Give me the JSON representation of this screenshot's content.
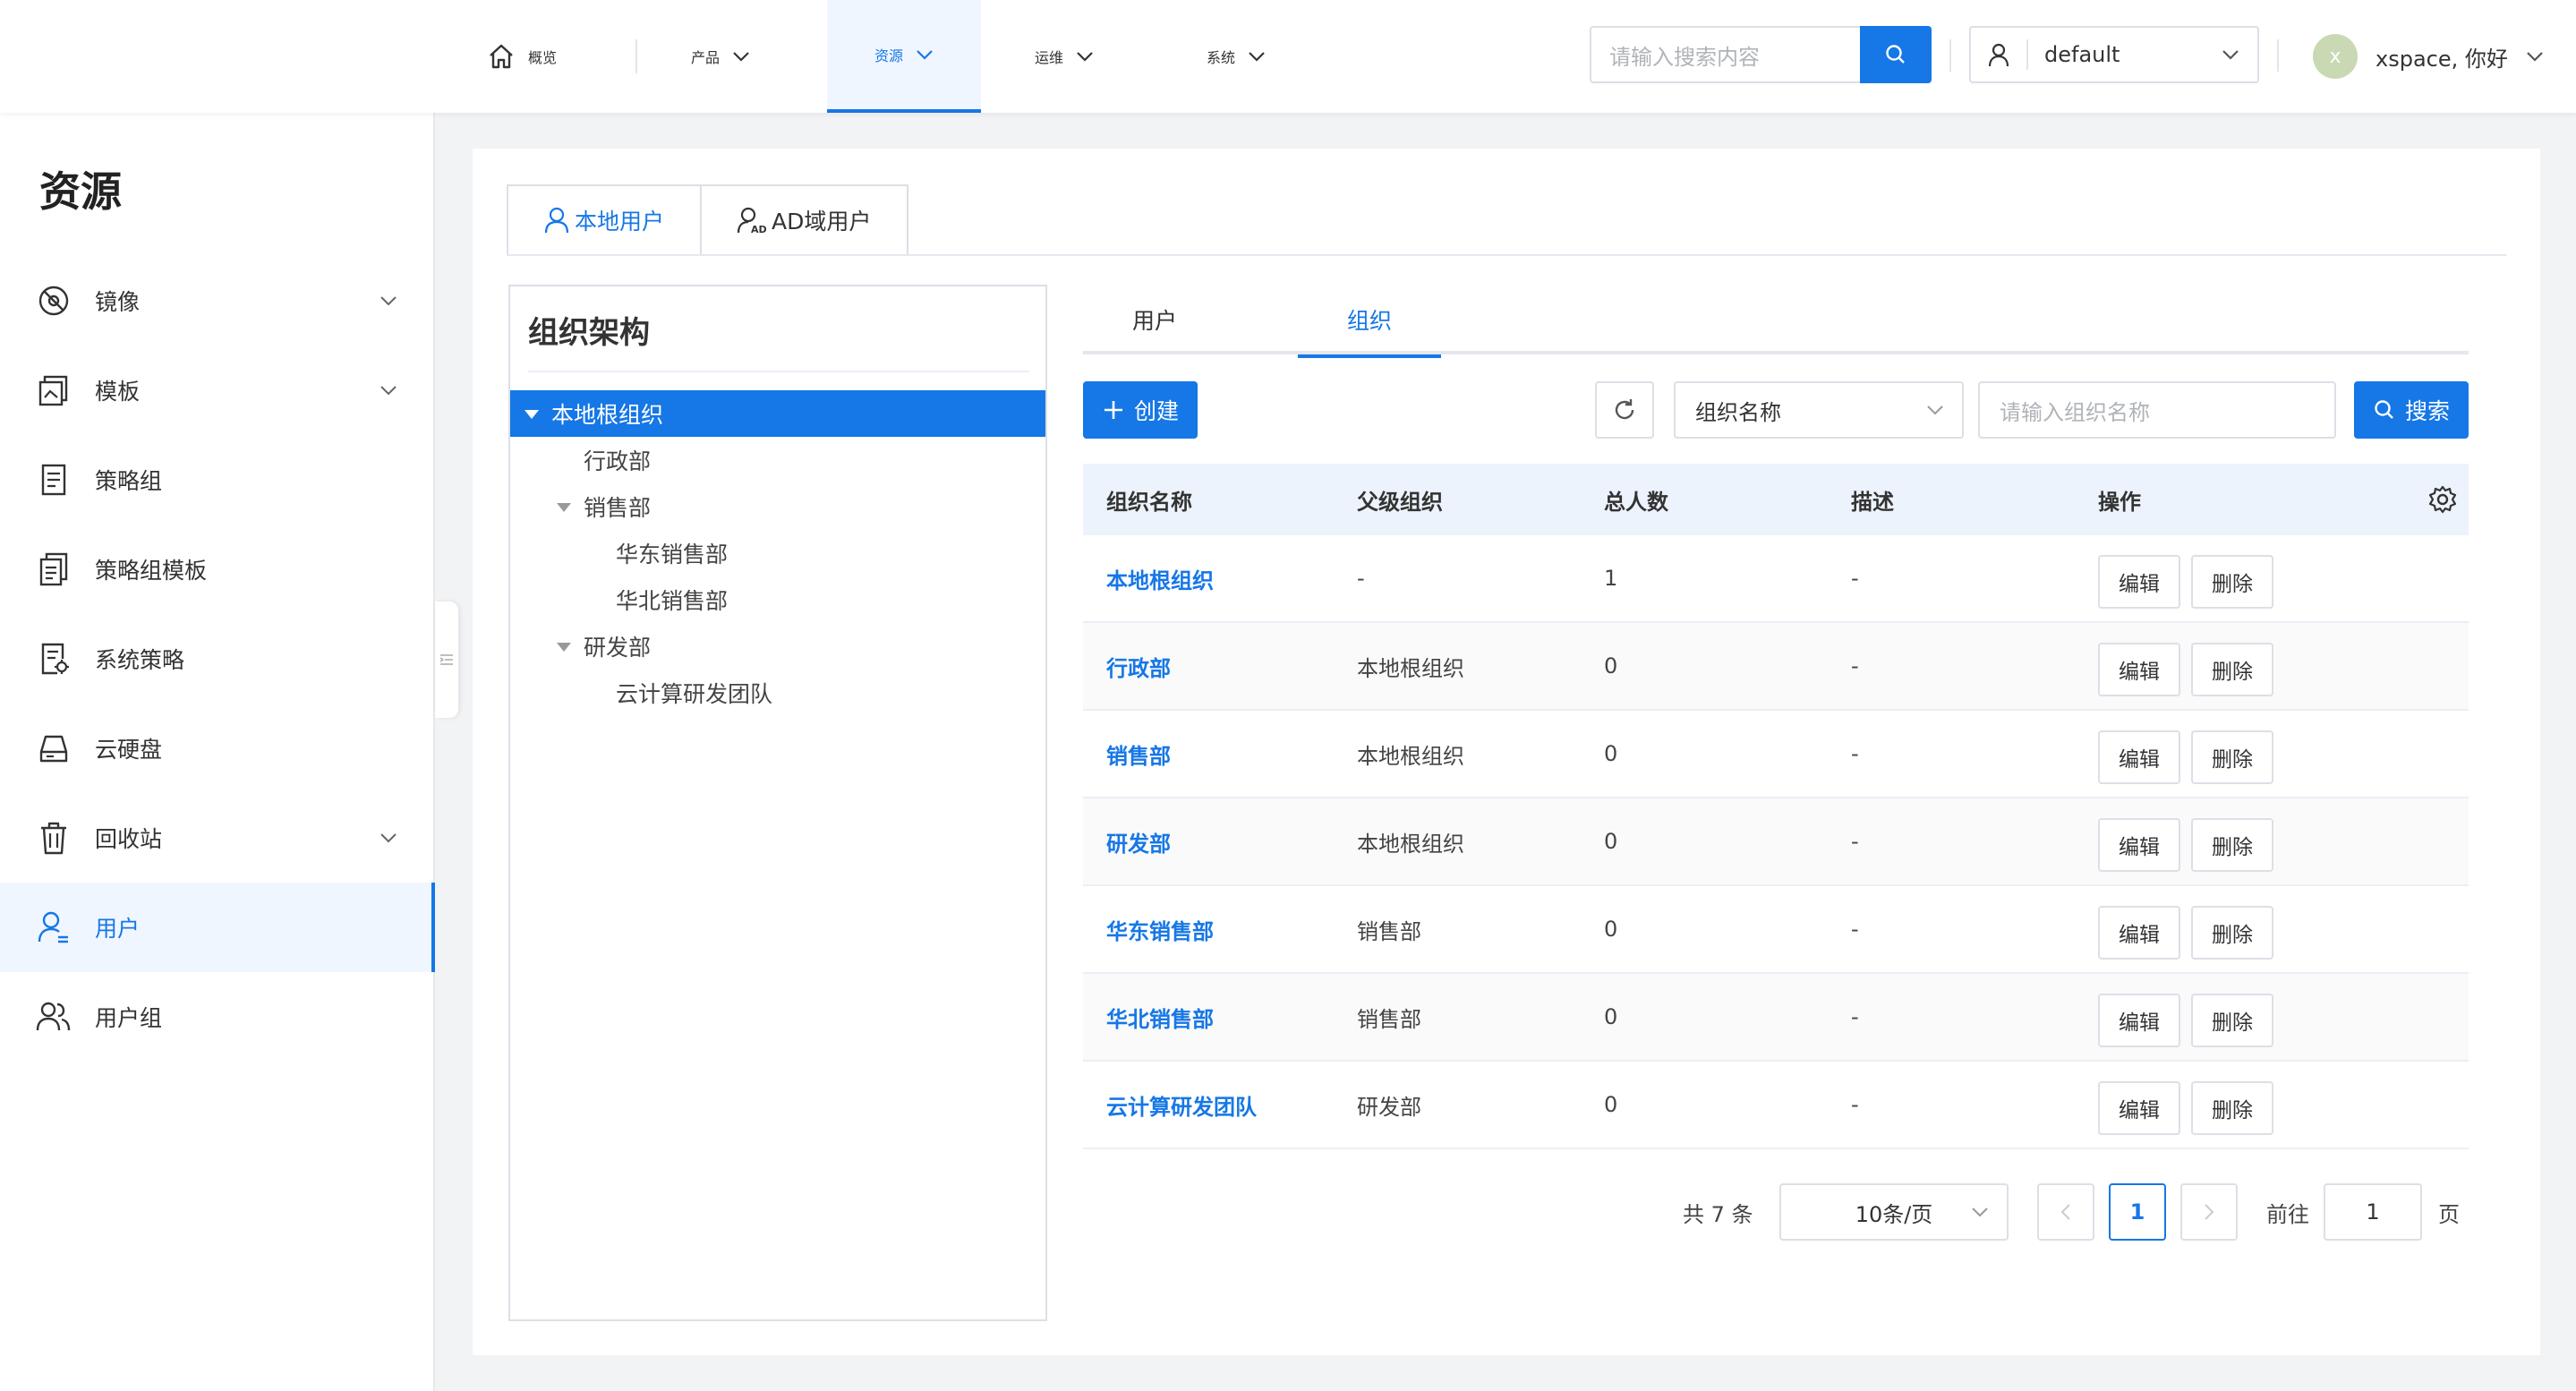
{
  "topnav": {
    "items": [
      {
        "label": "概览",
        "icon": "home-icon"
      },
      {
        "label": "产品"
      },
      {
        "label": "资源"
      },
      {
        "label": "运维"
      },
      {
        "label": "系统"
      }
    ],
    "search_placeholder": "请输入搜索内容",
    "project": "default",
    "greeting": "xspace, 你好",
    "avatar_letter": "x"
  },
  "sidebar": {
    "title": "资源",
    "items": [
      {
        "label": "镜像",
        "icon": "image-disc-icon",
        "expandable": true
      },
      {
        "label": "模板",
        "icon": "template-icon",
        "expandable": true
      },
      {
        "label": "策略组",
        "icon": "policy-group-icon"
      },
      {
        "label": "策略组模板",
        "icon": "policy-template-icon"
      },
      {
        "label": "系统策略",
        "icon": "system-policy-icon"
      },
      {
        "label": "云硬盘",
        "icon": "cloud-disk-icon"
      },
      {
        "label": "回收站",
        "icon": "trash-icon",
        "expandable": true
      },
      {
        "label": "用户",
        "icon": "user-icon",
        "active": true
      },
      {
        "label": "用户组",
        "icon": "user-group-icon"
      }
    ]
  },
  "user_tabs": [
    {
      "label": "本地用户",
      "active": true
    },
    {
      "label": "AD域用户"
    }
  ],
  "tree": {
    "title": "组织架构",
    "nodes": [
      {
        "label": "本地根组织",
        "level": 0,
        "expanded": true,
        "selected": true
      },
      {
        "label": "行政部",
        "level": 1
      },
      {
        "label": "销售部",
        "level": 1,
        "expanded": true
      },
      {
        "label": "华东销售部",
        "level": 2
      },
      {
        "label": "华北销售部",
        "level": 2
      },
      {
        "label": "研发部",
        "level": 1,
        "expanded": true
      },
      {
        "label": "云计算研发团队",
        "level": 2
      }
    ]
  },
  "sub_tabs": [
    {
      "label": "用户"
    },
    {
      "label": "组织",
      "active": true
    }
  ],
  "toolbar": {
    "create_label": "创建",
    "filter_field": "组织名称",
    "search_placeholder": "请输入组织名称",
    "search_label": "搜索"
  },
  "table": {
    "columns": [
      "组织名称",
      "父级组织",
      "总人数",
      "描述",
      "操作"
    ],
    "edit_label": "编辑",
    "delete_label": "删除",
    "rows": [
      {
        "name": "本地根组织",
        "parent": "-",
        "count": "1",
        "desc": "-"
      },
      {
        "name": "行政部",
        "parent": "本地根组织",
        "count": "0",
        "desc": "-"
      },
      {
        "name": "销售部",
        "parent": "本地根组织",
        "count": "0",
        "desc": "-"
      },
      {
        "name": "研发部",
        "parent": "本地根组织",
        "count": "0",
        "desc": "-"
      },
      {
        "name": "华东销售部",
        "parent": "销售部",
        "count": "0",
        "desc": "-"
      },
      {
        "name": "华北销售部",
        "parent": "销售部",
        "count": "0",
        "desc": "-"
      },
      {
        "name": "云计算研发团队",
        "parent": "研发部",
        "count": "0",
        "desc": "-"
      }
    ]
  },
  "pagination": {
    "total": "共 7 条",
    "page_size": "10条/页",
    "current_page": "1",
    "goto_label": "前往",
    "goto_value": "1",
    "page_unit": "页"
  },
  "colors": {
    "accent": "#1677e6",
    "header_bg": "#edf3fc"
  }
}
